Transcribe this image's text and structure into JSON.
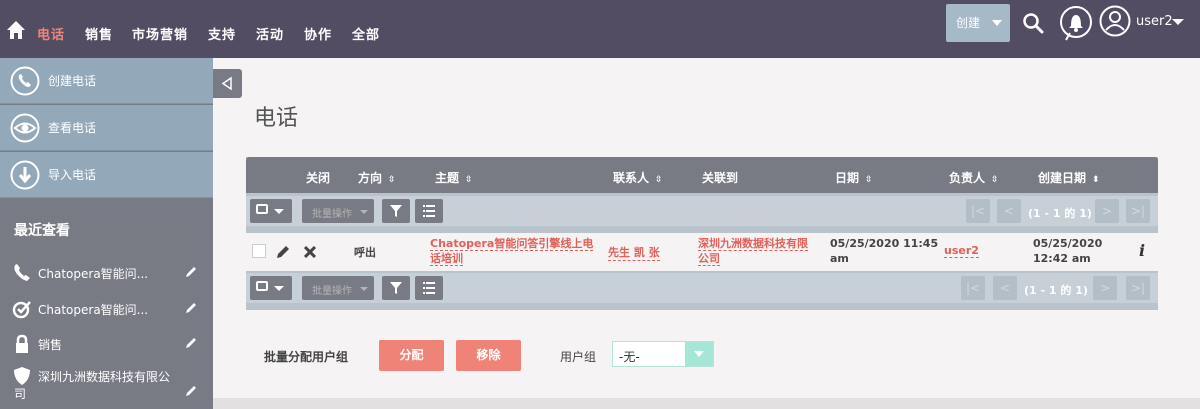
{
  "nav": {
    "items": [
      "电话",
      "销售",
      "市场营销",
      "支持",
      "活动",
      "协作",
      "全部"
    ],
    "active": "电话",
    "create_label": "创建",
    "user_name": "user2"
  },
  "sidebar": {
    "actions": [
      {
        "label": "创建电话",
        "icon": "phone-plus-icon"
      },
      {
        "label": "查看电话",
        "icon": "eye-icon"
      },
      {
        "label": "导入电话",
        "icon": "import-icon"
      }
    ],
    "recent_title": "最近查看",
    "recent": [
      {
        "label": "Chatopera智能问...",
        "icon": "phone-icon"
      },
      {
        "label": "Chatopera智能问...",
        "icon": "task-check-icon"
      },
      {
        "label": "销售",
        "icon": "lock-icon"
      },
      {
        "label": "深圳九洲数据科技有限公",
        "label2": "司",
        "icon": "shield-icon"
      }
    ]
  },
  "page": {
    "title": "电话"
  },
  "table": {
    "headers": [
      "关闭",
      "方向",
      "主题",
      "联系人",
      "关联到",
      "日期",
      "负责人",
      "创建日期"
    ],
    "bulk_label": "批量操作",
    "pagination": "(1 - 1 的 1)",
    "row": {
      "direction": "呼出",
      "subject_line1": "Chatopera智能问答引擎线上电",
      "subject_line2": "话培训",
      "contact": "先生 凯 张",
      "related_line1": "深圳九洲数据科技有限",
      "related_line2": "公司",
      "date_line1": "05/25/2020 11:45",
      "date_line2": "am",
      "assigned": "user2",
      "created_line1": "05/25/2020",
      "created_line2": "12:42 am",
      "info": "i"
    }
  },
  "mass_assign": {
    "label": "批量分配用户组",
    "assign_label": "分配",
    "remove_label": "移除",
    "group_label": "用户组",
    "group_value": "-无-"
  },
  "colors": {
    "nav_bg": "#534d64",
    "accent": "#f08377",
    "sidebar_bg": "#787a84",
    "action_bg": "#93a8b8"
  }
}
